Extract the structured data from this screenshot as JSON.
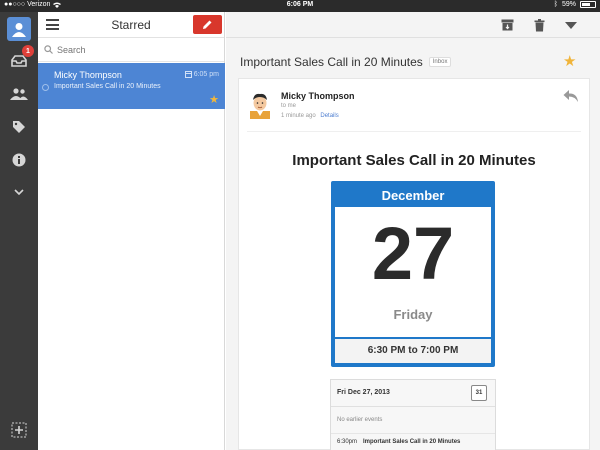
{
  "status_bar": {
    "carrier": "●●○○○ Verizon",
    "time": "6:06 PM",
    "battery": "59%"
  },
  "rail": {
    "inbox_badge": "1"
  },
  "list": {
    "title": "Starred",
    "search_placeholder": "Search",
    "items": [
      {
        "from": "Micky Thompson",
        "time": "6:05 pm",
        "subject": "Important Sales Call in 20 Minutes"
      }
    ]
  },
  "thread": {
    "title": "Important Sales Call in 20 Minutes",
    "label": "Inbox",
    "sender": "Micky Thompson",
    "to": "to me",
    "time_ago": "1 minute ago",
    "details_link": "Details",
    "heading": "Important Sales Call in 20 Minutes",
    "calendar": {
      "month": "December",
      "day": "27",
      "weekday": "Friday",
      "time_range": "6:30 PM to 7:00 PM"
    },
    "agenda": {
      "date": "Fri Dec 27, 2013",
      "icon_day": "31",
      "empty_text": "No earlier events",
      "event_time": "6:30pm",
      "event_name": "Important Sales Call in 20 Minutes"
    }
  },
  "colors": {
    "accent_blue": "#4d85d4",
    "compose_red": "#d8372c",
    "calendar_blue": "#1f78c9",
    "star": "#f0b43a"
  },
  "icons": [
    "menu-icon",
    "compose-icon",
    "search-icon",
    "archive-icon",
    "trash-icon",
    "more-icon",
    "star-icon",
    "reply-icon",
    "inbox-icon",
    "contacts-icon",
    "labels-icon",
    "info-icon",
    "chevron-down-icon",
    "add-account-icon",
    "calendar-icon"
  ]
}
